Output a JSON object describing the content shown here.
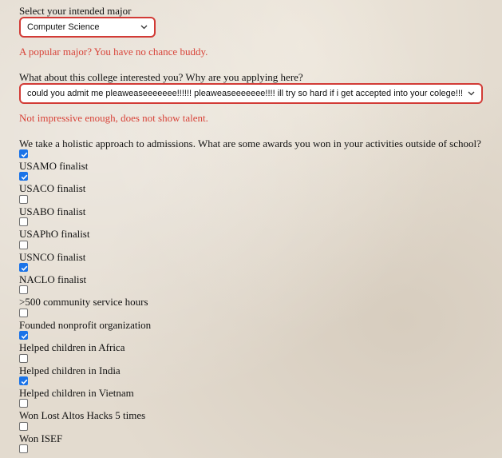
{
  "major": {
    "label": "Select your intended major",
    "selected": "Computer Science",
    "error": "A popular major? You have no chance buddy."
  },
  "interest": {
    "label": "What about this college interested you? Why are you applying here?",
    "selected": "could you admit me pleaweaseeeeeee!!!!!! pleaweaseeeeeee!!!! ill try so hard if i get accepted into your colege!!!",
    "error": "Not impressive enough, does not show talent."
  },
  "awards": {
    "question": "We take a holistic approach to admissions. What are some awards you won in your activities outside of school?",
    "items": [
      {
        "label": "USAMO finalist",
        "checked": true
      },
      {
        "label": "USACO finalist",
        "checked": true
      },
      {
        "label": "USABO finalist",
        "checked": false
      },
      {
        "label": "USAPhO finalist",
        "checked": false
      },
      {
        "label": "USNCO finalist",
        "checked": false
      },
      {
        "label": "NACLO finalist",
        "checked": true
      },
      {
        "label": ">500 community service hours",
        "checked": false
      },
      {
        "label": "Founded nonprofit organization",
        "checked": false
      },
      {
        "label": "Helped children in Africa",
        "checked": true
      },
      {
        "label": "Helped children in India",
        "checked": false
      },
      {
        "label": "Helped children in Vietnam",
        "checked": true
      },
      {
        "label": "Won Lost Altos Hacks 5 times",
        "checked": false
      },
      {
        "label": "Won ISEF",
        "checked": false
      }
    ]
  },
  "icons": {
    "dropdown": "chevron-down-icon",
    "check": "checkmark-icon"
  },
  "colors": {
    "error": "#d8443a",
    "select_border": "#d23b36",
    "checkbox_checked": "#1a73e8"
  }
}
